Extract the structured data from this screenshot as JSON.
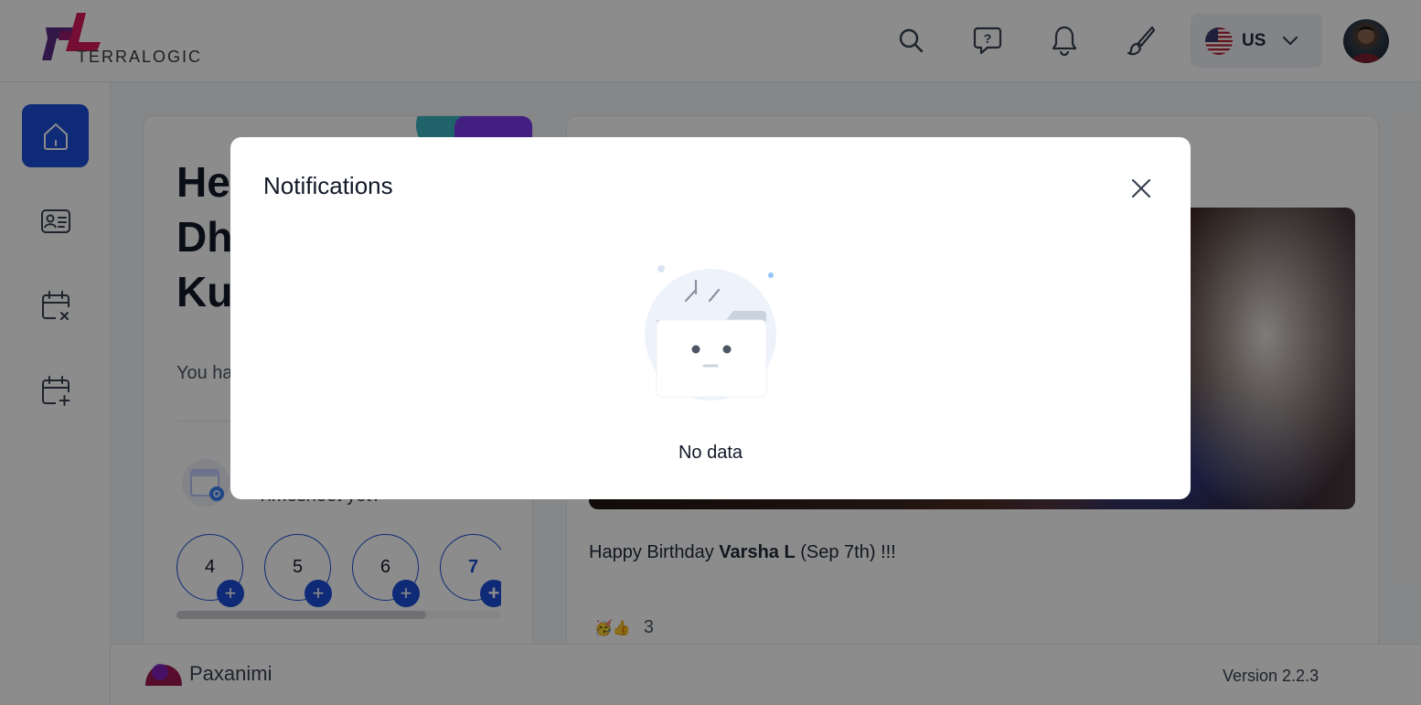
{
  "header": {
    "logo_text": "TERRALOGIC",
    "icons": [
      "search-icon",
      "help-chat-icon",
      "bell-icon",
      "brush-icon"
    ],
    "language": {
      "code": "US",
      "flag": "us-flag-icon"
    }
  },
  "sidebar": {
    "items": [
      {
        "icon": "home-icon",
        "active": true
      },
      {
        "icon": "id-card-icon",
        "active": false
      },
      {
        "icon": "calendar-x-icon",
        "active": false
      },
      {
        "icon": "calendar-plus-icon",
        "active": false
      }
    ]
  },
  "left_card": {
    "greeting_lines": [
      "He",
      "Dh",
      "Ku"
    ],
    "subtitle": "You ha",
    "timesheet_text": "Timesheet yet?",
    "days": [
      "4",
      "5",
      "6",
      "7"
    ],
    "scroll_progress": 0.77
  },
  "right_card": {
    "birthday_prefix": "Happy Birthday ",
    "birthday_name": "Varsha L",
    "birthday_suffix": " (Sep 7th) !!!",
    "reaction_emojis": "🥳👍",
    "reaction_count": "3"
  },
  "footer": {
    "brand": "Paxanimi",
    "version": "Version 2.2.3"
  },
  "modal": {
    "title": "Notifications",
    "empty_text": "No data"
  },
  "colors": {
    "primary": "#1d4ed8",
    "brand_magenta": "#c2185b",
    "brand_purple": "#6d28d9"
  }
}
